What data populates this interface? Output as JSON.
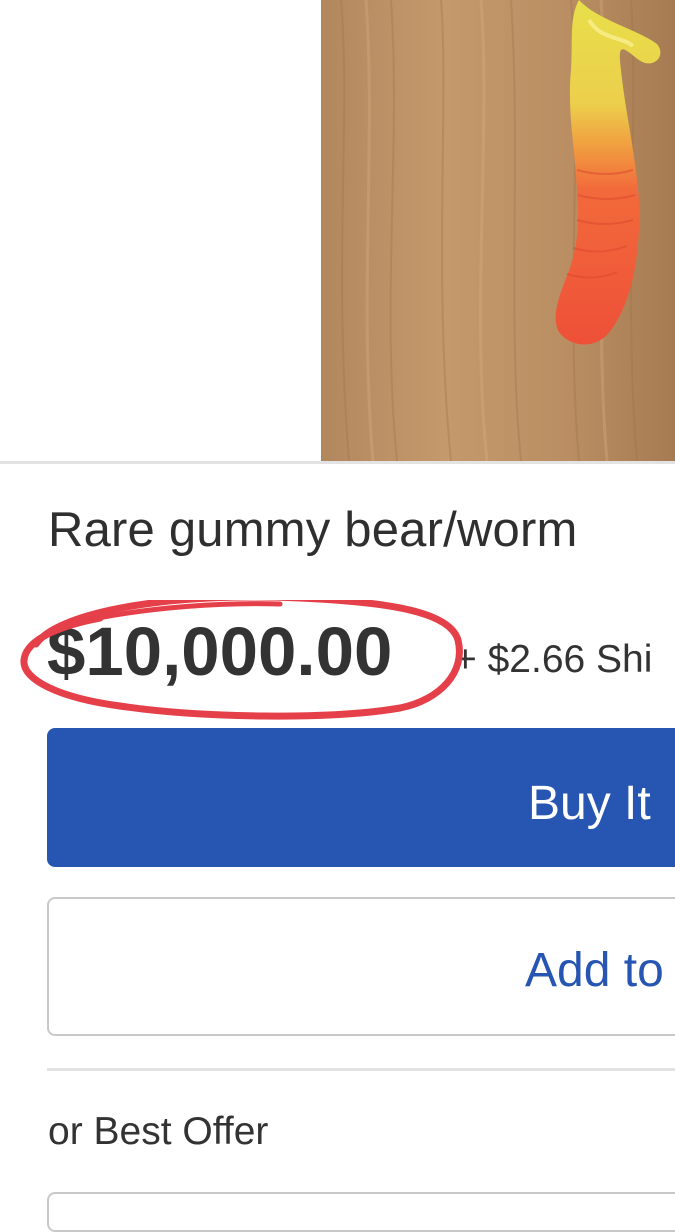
{
  "listing": {
    "image_name": "gummy-worm-photo",
    "title": "Rare gummy bear/worm",
    "price": "$10,000.00",
    "shipping": "+ $2.66 Shi"
  },
  "actions": {
    "buy_label": "Buy It",
    "cart_label": "Add to"
  },
  "offer": {
    "label": "or Best Offer"
  },
  "colors": {
    "accent_blue": "#2655b2",
    "annotation_red": "#e5404a",
    "text": "#333333"
  },
  "icons": {
    "annotation": "red-hand-drawn-circle"
  }
}
